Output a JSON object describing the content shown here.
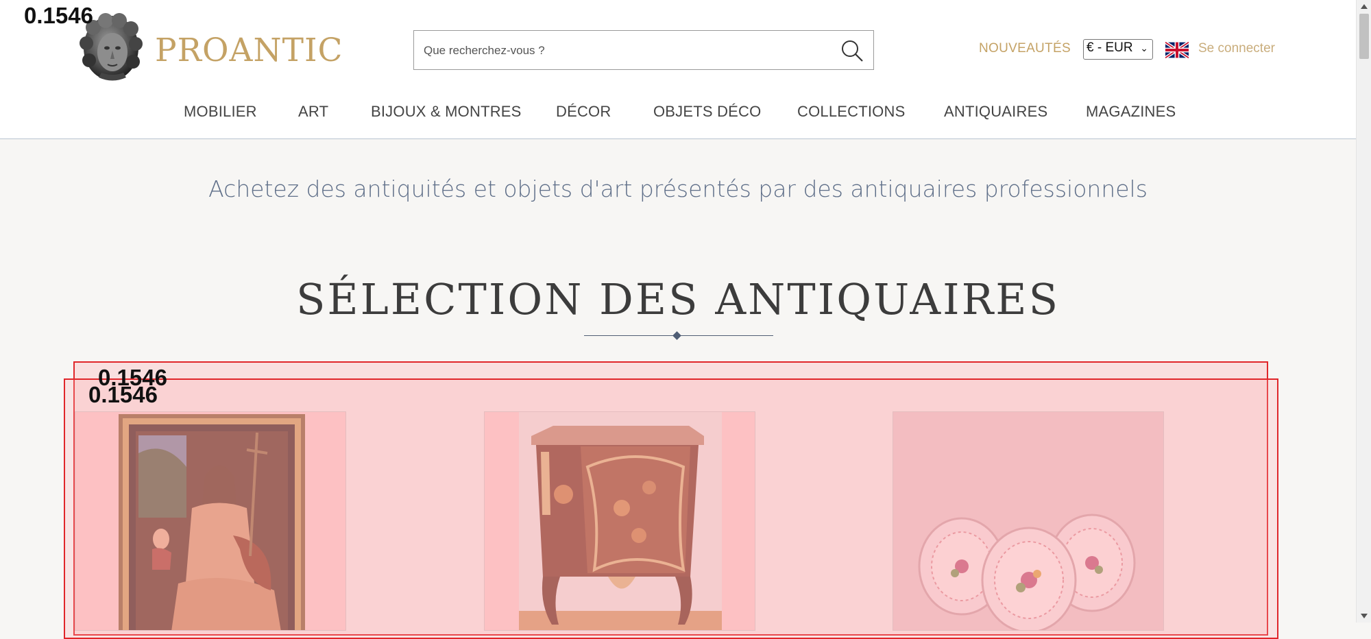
{
  "logo": {
    "text": "PROANTIC"
  },
  "search": {
    "placeholder": "Que recherchez-vous ?"
  },
  "header": {
    "new_label": "NOUVEAUTÉS",
    "currency": "€ - EUR",
    "login_label": "Se connecter"
  },
  "nav": {
    "items": [
      {
        "label": "MOBILIER"
      },
      {
        "label": "ART"
      },
      {
        "label": "BIJOUX & MONTRES"
      },
      {
        "label": "DÉCOR"
      },
      {
        "label": "OBJETS DÉCO"
      },
      {
        "label": "COLLECTIONS"
      },
      {
        "label": "ANTIQUAIRES"
      },
      {
        "label": "MAGAZINES"
      }
    ]
  },
  "main": {
    "tagline": "Achetez des antiquités et objets d'art présentés par des antiquaires professionnels",
    "section_title": "SÉLECTION DES ANTIQUAIRES"
  },
  "overlay": {
    "scores": [
      "0.1546",
      "0.1546",
      "0.1546"
    ]
  },
  "colors": {
    "brand_gold": "#c4a265",
    "nav_text": "#444444",
    "tagline_blue": "#5e6e88",
    "highlight_red": "#e0262a"
  },
  "icons": [
    "search-icon",
    "uk-flag-icon",
    "chevron-down-icon"
  ]
}
